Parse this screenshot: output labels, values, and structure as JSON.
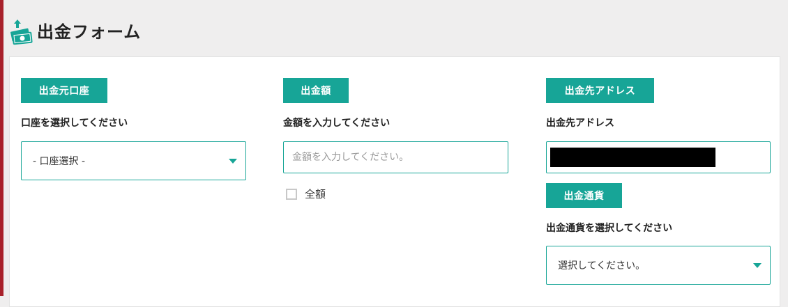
{
  "header": {
    "title": "出金フォーム",
    "icon": "money-withdraw-icon"
  },
  "colors": {
    "accent": "#17a597",
    "left_bar": "#a8212b",
    "background": "#efeeee"
  },
  "source_account": {
    "tag": "出金元口座",
    "label": "口座を選択してください",
    "selected": "- 口座選択 -"
  },
  "amount": {
    "tag": "出金額",
    "label": "金額を入力してください",
    "placeholder": "金額を入力してください。",
    "value": "",
    "all_amount_label": "全額",
    "all_amount_checked": false
  },
  "destination": {
    "tag": "出金先アドレス",
    "label": "出金先アドレス",
    "value_redacted": true
  },
  "currency": {
    "tag": "出金通貨",
    "label": "出金通貨を選択してください",
    "selected": "選択してください。"
  }
}
